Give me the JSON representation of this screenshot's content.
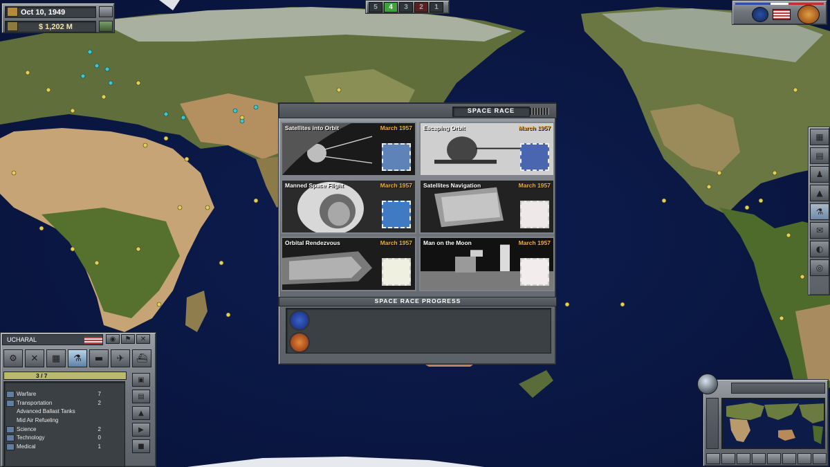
{
  "top_bar": {
    "date": "Oct 10, 1949",
    "money": "$ 1,202 M",
    "speed_options": [
      "5",
      "4",
      "3",
      "2",
      "1"
    ],
    "active_speed": "4"
  },
  "dialog": {
    "title": "SPACE RACE",
    "projects": [
      {
        "name": "Satellites into Orbit",
        "date": "March 1957"
      },
      {
        "name": "Escaping Orbit",
        "date": "March 1957"
      },
      {
        "name": "Manned Space Flight",
        "date": "March 1957"
      },
      {
        "name": "Satellites Navigation",
        "date": "March 1957"
      },
      {
        "name": "Orbital Rendezvous",
        "date": "March 1957"
      },
      {
        "name": "Man on the Moon",
        "date": "March 1957"
      }
    ],
    "progress_title": "SPACE RACE PROGRESS",
    "agencies": [
      "NASA",
      "Soviet space program"
    ],
    "progress": [
      0,
      0
    ]
  },
  "unit_panel": {
    "name": "UCHARAL",
    "count": "3 / 7",
    "items": [
      {
        "label": "Warfare",
        "value": "7",
        "icon": "warfare-icon"
      },
      {
        "label": "Transportation",
        "value": "2",
        "icon": "transport-icon"
      },
      {
        "label": "Advanced Ballast Tanks",
        "value": "",
        "icon": ""
      },
      {
        "label": "Mid Air Refueling",
        "value": "",
        "icon": ""
      },
      {
        "label": "Science",
        "value": "2",
        "icon": "science-icon"
      },
      {
        "label": "Technology",
        "value": "0",
        "icon": "technology-icon"
      },
      {
        "label": "Medical",
        "value": "1",
        "icon": "medical-icon"
      }
    ]
  },
  "colors": {
    "ocean": "#0b1a4a",
    "panel": "#6f757b",
    "date_accent": "#f1b33a",
    "active_speed": "#3fa23a"
  }
}
